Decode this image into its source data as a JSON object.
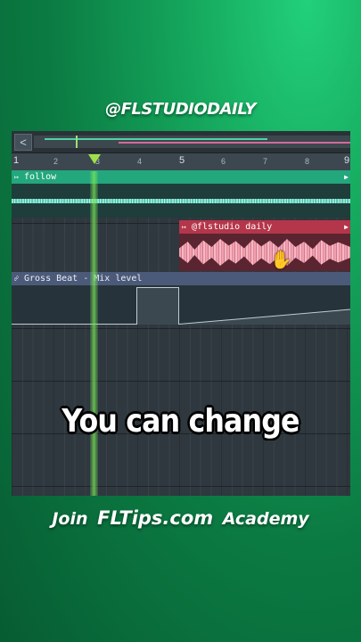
{
  "overlay": {
    "handle": "@FLSTUDIODAILY",
    "caption": "You can change",
    "footer_prefix": "Join",
    "footer_brand": "FLTips.com",
    "footer_suffix": "Academy"
  },
  "playlist": {
    "scroll_button_icon": "chevron-left-icon",
    "scroll_button_label": "<",
    "ruler_numbers": [
      "1",
      "2",
      "3",
      "4",
      "5",
      "6",
      "7",
      "8",
      "9"
    ],
    "tracks": [
      {
        "name": "follow",
        "color": "#23a77c",
        "type": "audio"
      },
      {
        "name": "@flstudio daily",
        "color": "#b4364a",
        "type": "audio"
      },
      {
        "name": "Gross Beat - Mix level",
        "color": "#4b5a78",
        "type": "automation"
      }
    ],
    "playhead_color": "#9fe04a"
  }
}
